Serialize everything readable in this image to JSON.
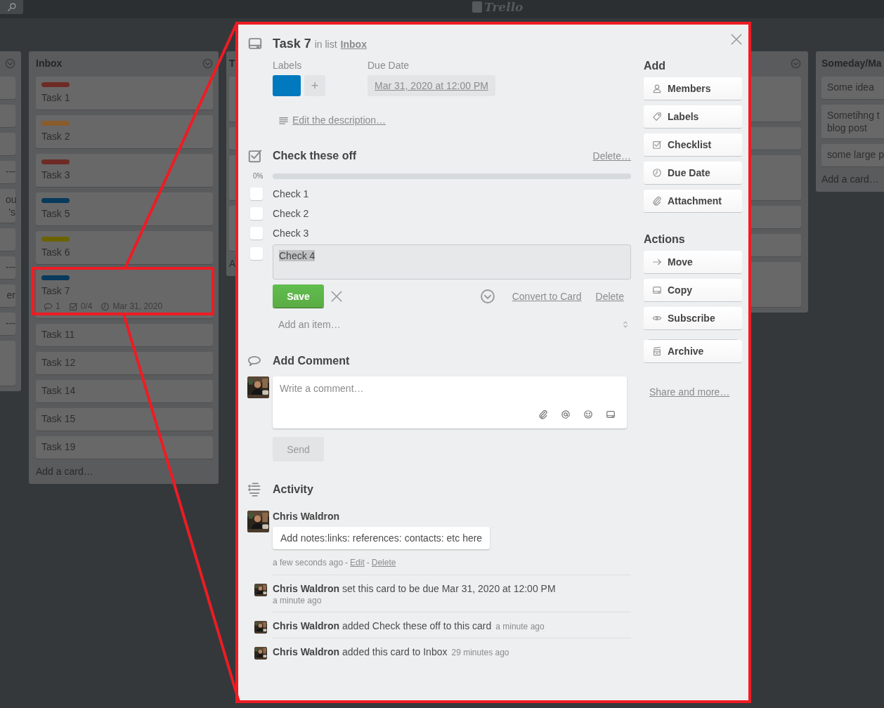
{
  "header": {
    "logo": "Trello"
  },
  "lists": [
    {
      "kind": "edge-left",
      "cards": [
        {
          "kind": "blank"
        },
        {
          "kind": "blank"
        },
        {
          "kind": "blank"
        },
        {
          "kind": "text",
          "lines": [
            "---"
          ]
        },
        {
          "kind": "text",
          "lines": [
            "ou",
            "'s"
          ]
        },
        {
          "kind": "blank"
        },
        {
          "kind": "text",
          "lines": [
            "---"
          ]
        },
        {
          "kind": "text",
          "lines": [
            "er"
          ]
        },
        {
          "kind": "text",
          "lines": [
            "---"
          ]
        },
        {
          "kind": "tall"
        }
      ]
    },
    {
      "kind": "full",
      "title": "Inbox",
      "add": "Add a card…",
      "cards": [
        {
          "kind": "text",
          "lines": [
            "Task 1"
          ],
          "color": "#6e2b25"
        },
        {
          "kind": "text",
          "lines": [
            "Task 2"
          ],
          "color": "#8a5b2b"
        },
        {
          "kind": "text",
          "lines": [
            "Task 3"
          ],
          "color": "#6e2b25"
        },
        {
          "kind": "text",
          "lines": [
            "Task 5"
          ],
          "color": "#073a5c"
        },
        {
          "kind": "text",
          "lines": [
            "Task 6"
          ],
          "color": "#6b6200"
        },
        {
          "kind": "text",
          "lines": [
            "Task 7"
          ],
          "color": "#073a5c",
          "badges": {
            "comments": "1",
            "checklist": "0/4",
            "due": "Mar 31, 2020"
          }
        },
        {
          "kind": "text",
          "lines": [
            "Task 11"
          ]
        },
        {
          "kind": "text",
          "lines": [
            "Task 12"
          ]
        },
        {
          "kind": "text",
          "lines": [
            "Task 14"
          ]
        },
        {
          "kind": "text",
          "lines": [
            "Task 15"
          ]
        },
        {
          "kind": "text",
          "lines": [
            "Task 19"
          ]
        }
      ]
    },
    {
      "kind": "edge-modal",
      "title": "T",
      "add": "A",
      "cards": [
        {
          "kind": "tall"
        },
        {
          "kind": "blank"
        },
        {
          "kind": "tall"
        },
        {
          "kind": "tall"
        }
      ]
    },
    {
      "kind": "edge-right",
      "cards": [
        {
          "kind": "tall"
        },
        {
          "kind": "blank"
        },
        {
          "kind": "tall"
        },
        {
          "kind": "blank"
        },
        {
          "kind": "blank"
        },
        {
          "kind": "tall"
        }
      ]
    },
    {
      "kind": "edge-window",
      "title": "Someday/Ma",
      "add": "Add a card…",
      "cards": [
        {
          "kind": "text",
          "lines": [
            "Some idea"
          ]
        },
        {
          "kind": "text",
          "lines": [
            "Sometihng t",
            "blog post"
          ]
        },
        {
          "kind": "text",
          "lines": [
            "some large p"
          ]
        }
      ]
    }
  ],
  "card_modal": {
    "title": "Task 7",
    "in_list": "in list",
    "list_link": "Inbox",
    "labels": {
      "heading": "Labels",
      "chips": [
        {
          "color": "#0079bf"
        }
      ],
      "add": "+"
    },
    "due": {
      "heading": "Due Date",
      "value": "Mar 31, 2020 at 12:00 PM"
    },
    "description_link": "Edit the description…",
    "checklist": {
      "title": "Check these off",
      "delete": "Delete…",
      "percent": "0%",
      "level": 0,
      "items": [
        {
          "text": "Check 1",
          "checked": false,
          "editing": false
        },
        {
          "text": "Check 2",
          "checked": false,
          "editing": false
        },
        {
          "text": "Check 3",
          "checked": false,
          "editing": false
        },
        {
          "text": "Check 4",
          "checked": false,
          "editing": true
        }
      ],
      "save": "Save",
      "convert": "Convert to Card",
      "item_delete": "Delete",
      "add_placeholder": "Add an item…"
    },
    "comment": {
      "heading": "Add Comment",
      "placeholder": "Write a comment…",
      "send": "Send",
      "send_disabled": true
    },
    "activity": {
      "heading": "Activity",
      "comment": {
        "author": "Chris Waldron",
        "text": "Add notes:links: references: contacts: etc here",
        "time": "a few seconds ago",
        "separators": [
          "-",
          "-"
        ],
        "edit": "Edit",
        "delete": "Delete"
      },
      "events": [
        {
          "kind": "block",
          "text": "**Chris Waldron** set this card to be due Mar 31, 2020 at 12:00 PM",
          "time": "a minute ago"
        },
        {
          "kind": "inline",
          "text": "**Chris Waldron** added Check these off to this card",
          "time": "a minute ago"
        },
        {
          "kind": "inline",
          "text": "**Chris Waldron** added this card to Inbox",
          "time": "29 minutes ago"
        }
      ]
    },
    "sidebar": {
      "add_heading": "Add",
      "add_buttons": [
        {
          "label": "Members"
        },
        {
          "label": "Labels"
        },
        {
          "label": "Checklist"
        },
        {
          "label": "Due Date"
        },
        {
          "label": "Attachment"
        }
      ],
      "actions_heading": "Actions",
      "action_buttons": [
        {
          "label": "Move",
          "separated": false
        },
        {
          "label": "Copy",
          "separated": false
        },
        {
          "label": "Subscribe",
          "separated": false
        },
        {
          "label": "Archive",
          "separated": true
        }
      ],
      "share": "Share and more…"
    }
  }
}
